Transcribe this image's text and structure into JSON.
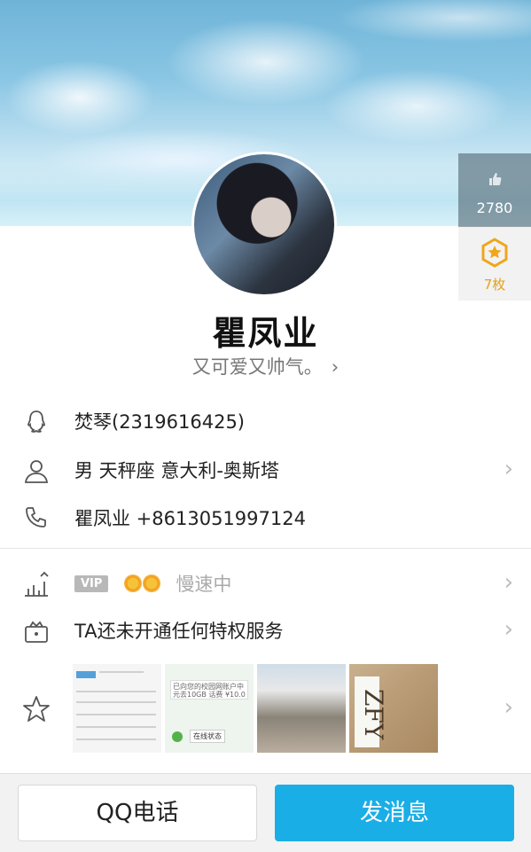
{
  "likes": {
    "count": "2780",
    "icon": "thumb-up-icon"
  },
  "medal": {
    "count": "7枚",
    "icon": "medal-icon",
    "color": "#e4a017"
  },
  "profile": {
    "name": "瞿凤业",
    "signature": "又可爱又帅气。",
    "signature_chevron": "›"
  },
  "info": {
    "qq": {
      "icon": "penguin-icon",
      "text": "焚琴(2319616425)"
    },
    "personal": {
      "icon": "person-icon",
      "text": "男  天秤座  意大利-奥斯塔"
    },
    "phone": {
      "icon": "phone-icon",
      "text": "瞿凤业 +8613051997124"
    }
  },
  "vip": {
    "icon": "level-icon",
    "badge": "VIP",
    "status": "慢速中"
  },
  "privilege": {
    "icon": "crown-box-icon",
    "text": "TA还未开通任何特权服务"
  },
  "photos": {
    "icon": "star-icon",
    "p2_bubble": "已向您的校园网账户中 元去10GB 话费 ¥10.0",
    "p2_tag": "在线状态",
    "p4_write": "ZFY"
  },
  "buttons": {
    "call": "QQ电话",
    "message": "发消息"
  },
  "colors": {
    "accent": "#1aaee6",
    "medal": "#e4a017"
  }
}
